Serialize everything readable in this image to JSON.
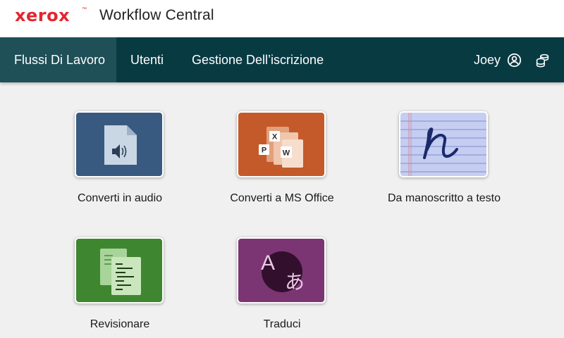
{
  "header": {
    "brand": "xerox",
    "trademark": "™",
    "app_title": "Workflow Central"
  },
  "nav": {
    "items": [
      {
        "label": "Flussi Di Lavoro",
        "active": true
      },
      {
        "label": "Utenti",
        "active": false
      },
      {
        "label": "Gestione Dell’iscrizione",
        "active": false
      }
    ],
    "user_name": "Joey",
    "icons": [
      "account-icon",
      "credits-icon"
    ]
  },
  "workflows": [
    {
      "label": "Converti in audio",
      "icon": "audio-file-icon",
      "color": "#385a80"
    },
    {
      "label": "Converti a MS Office",
      "icon": "ms-office-icon",
      "color": "#c45a2a"
    },
    {
      "label": "Da manoscritto a testo",
      "icon": "handwriting-icon",
      "color": "#c5cdf1"
    },
    {
      "label": "Revisionare",
      "icon": "documents-icon",
      "color": "#3f8630"
    },
    {
      "label": "Traduci",
      "icon": "translate-icon",
      "color": "#7b3573"
    }
  ],
  "office_letters": [
    "X",
    "P",
    "W"
  ],
  "translate_letters": [
    "A",
    "あ"
  ],
  "handwriting_glyph": "n"
}
